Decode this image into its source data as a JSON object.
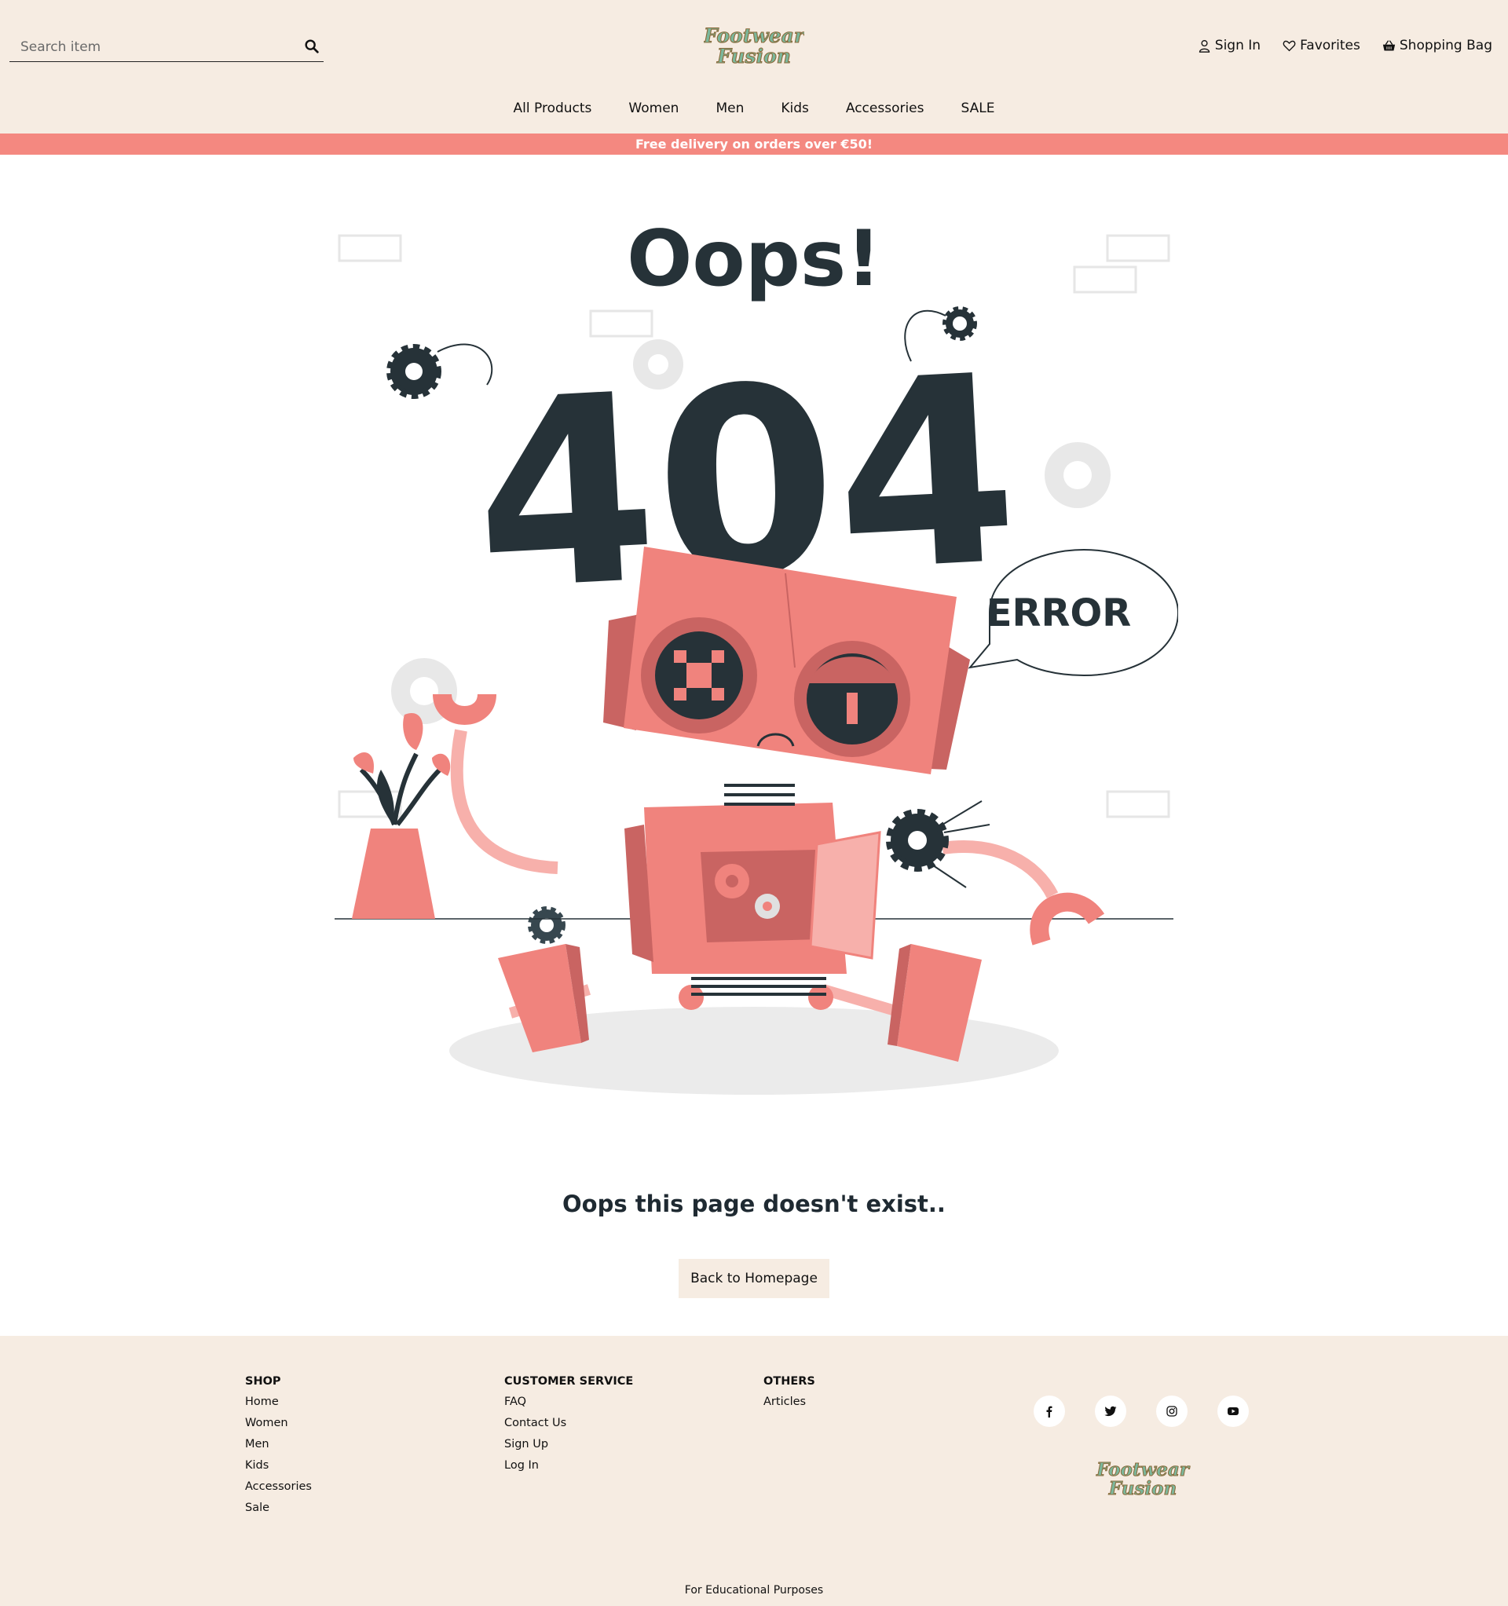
{
  "header": {
    "search_placeholder": "Search item",
    "logo_text_top": "Footwear",
    "logo_text_bottom": "Fusion",
    "user_nav": {
      "sign_in": "Sign In",
      "favorites": "Favorites",
      "bag": "Shopping Bag"
    }
  },
  "nav": {
    "items": [
      "All Products",
      "Women",
      "Men",
      "Kids",
      "Accessories",
      "SALE"
    ]
  },
  "promo": "Free delivery on orders over €50!",
  "illustration": {
    "title": "Oops!",
    "code": "404",
    "bubble": "ERROR"
  },
  "message": "Oops this page doesn't exist..",
  "back_button": "Back to Homepage",
  "footer": {
    "shop": {
      "title": "SHOP",
      "links": [
        "Home",
        "Women",
        "Men",
        "Kids",
        "Accessories",
        "Sale"
      ]
    },
    "service": {
      "title": "CUSTOMER SERVICE",
      "links": [
        "FAQ",
        "Contact Us",
        "Sign Up",
        "Log In"
      ]
    },
    "others": {
      "title": "OTHERS",
      "links": [
        "Articles"
      ]
    },
    "socials": [
      "facebook-icon",
      "twitter-icon",
      "instagram-icon",
      "youtube-icon"
    ],
    "note": "For Educational Purposes"
  },
  "colors": {
    "cream": "#f6ece2",
    "salmon": "#f48880",
    "robot": "#f0837d",
    "dark": "#263238"
  }
}
